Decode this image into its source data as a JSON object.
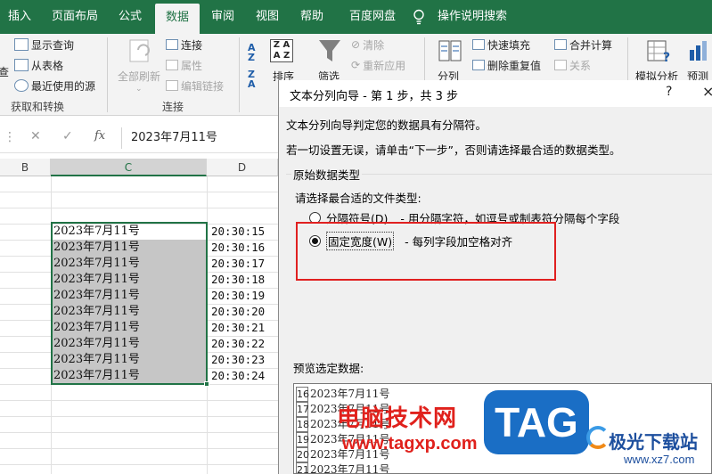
{
  "ribbon_tabs": [
    "插入",
    "页面布局",
    "公式",
    "数据",
    "审阅",
    "视图",
    "帮助",
    "百度网盘",
    "操作说明搜索"
  ],
  "ribbon": {
    "get_transform": {
      "items": [
        "显示查询",
        "从表格",
        "最近使用的源"
      ],
      "partial_item": "查",
      "label": "获取和转换"
    },
    "connections": {
      "refresh_all": "全部刷新",
      "items": [
        "连接",
        "属性",
        "编辑链接"
      ],
      "label": "连接"
    },
    "sort": {
      "label": "排序"
    },
    "filter": {
      "label": "筛选",
      "items": [
        "清除",
        "重新应用"
      ]
    },
    "data_tools": {
      "split": "分列",
      "items": [
        "快速填充",
        "删除重复值",
        "合并计算",
        "关系"
      ]
    },
    "forecast": {
      "what_if": "模拟分析",
      "forecast": "预测"
    }
  },
  "formula_bar": {
    "fx": "fx",
    "value": "2023年7月11号"
  },
  "columns": [
    "B",
    "C",
    "D"
  ],
  "cells": {
    "dates": [
      "2023年7月11号",
      "2023年7月11号",
      "2023年7月11号",
      "2023年7月11号",
      "2023年7月11号",
      "2023年7月11号",
      "2023年7月11号",
      "2023年7月11号",
      "2023年7月11号",
      "2023年7月11号"
    ],
    "times": [
      "20:30:15",
      "20:30:16",
      "20:30:17",
      "20:30:18",
      "20:30:19",
      "20:30:20",
      "20:30:21",
      "20:30:22",
      "20:30:23",
      "20:30:24"
    ]
  },
  "dialog": {
    "title": "文本分列向导 - 第 1 步，共 3 步",
    "help": "?",
    "close": "×",
    "line1": "文本分列向导判定您的数据具有分隔符。",
    "line2": "若一切设置无误，请单击“下一步”，否则请选择最合适的数据类型。",
    "group_title": "原始数据类型",
    "prompt": "请选择最合适的文件类型:",
    "option_delimited": "分隔符号(D)",
    "option_delimited_desc": "- 用分隔字符，如逗号或制表符分隔每个字段",
    "option_fixed": "固定宽度(W)",
    "option_fixed_desc": "- 每列字段加空格对齐",
    "selected_option": "fixed",
    "preview_label": "预览选定数据:",
    "preview_rows": [
      {
        "n": "16",
        "v": "2023年7月11号"
      },
      {
        "n": "17",
        "v": "2023年7月11号"
      },
      {
        "n": "18",
        "v": "2023年7月11号"
      },
      {
        "n": "19",
        "v": "2023年7月11号"
      },
      {
        "n": "20",
        "v": "2023年7月11号"
      },
      {
        "n": "21",
        "v": "2023年7月11号"
      }
    ]
  },
  "watermarks": {
    "site_cn": "电脑技术网",
    "site_url": "www.tagxp.com",
    "tag": "TAG",
    "site2_cn": "极光下载站",
    "site2_url": "www.xz7.com"
  },
  "colors": {
    "excel_green": "#217346",
    "highlight_red": "#e02020",
    "tag_blue": "#1a6ec5"
  }
}
